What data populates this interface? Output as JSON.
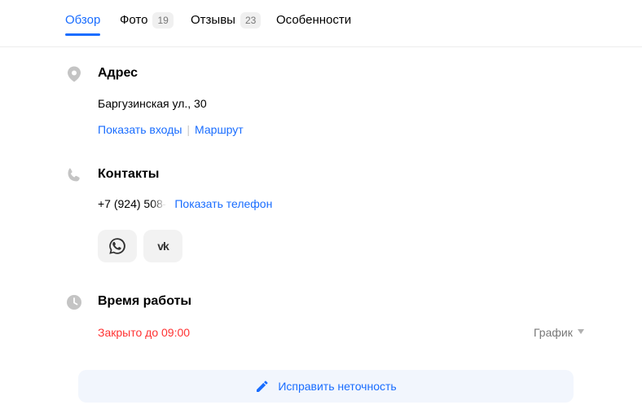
{
  "tabs": [
    {
      "label": "Обзор",
      "badge": ""
    },
    {
      "label": "Фото",
      "badge": "19"
    },
    {
      "label": "Отзывы",
      "badge": "23"
    },
    {
      "label": "Особенности",
      "badge": ""
    }
  ],
  "active_tab": "Обзор",
  "address": {
    "title": "Адрес",
    "value": "Баргузинская ул., 30",
    "show_entrances": "Показать входы",
    "separator": "|",
    "route": "Маршрут",
    "icon": "location-pin-icon"
  },
  "contacts": {
    "title": "Контакты",
    "phone_partial": "+7 (924) 508-",
    "show_phone": "Показать телефон",
    "icon": "phone-icon",
    "social": [
      {
        "name": "whatsapp",
        "icon": "whatsapp-icon"
      },
      {
        "name": "vk",
        "label": "vk",
        "icon": "vk-icon"
      }
    ]
  },
  "hours": {
    "title": "Время работы",
    "status": "Закрыто до 09:00",
    "schedule_label": "График",
    "icon": "clock-icon"
  },
  "fix_button": {
    "label": "Исправить неточность",
    "icon": "pencil-icon"
  },
  "colors": {
    "accent": "#196dff",
    "closed": "#ff3333",
    "icon_gray": "#c4c4c4"
  }
}
